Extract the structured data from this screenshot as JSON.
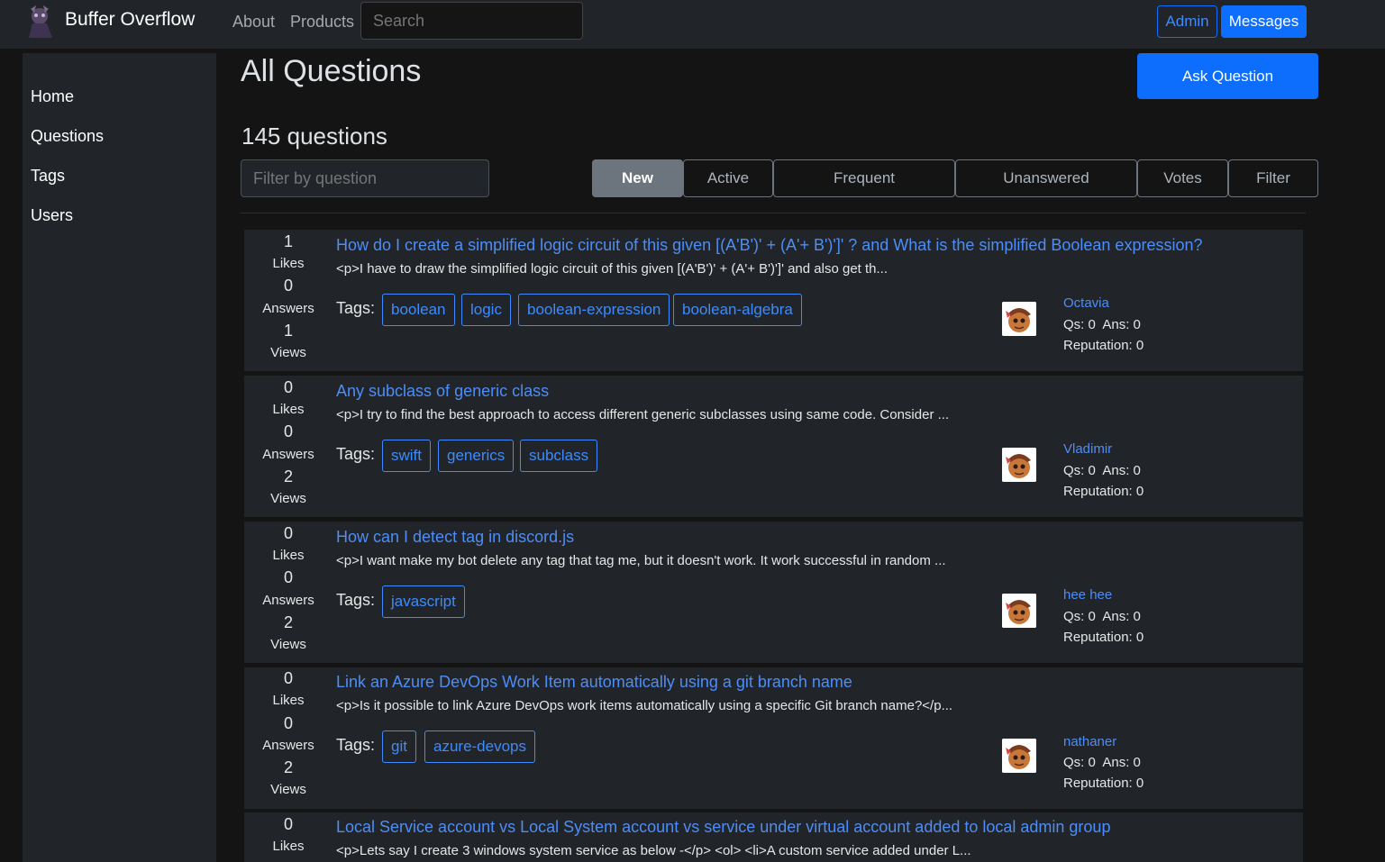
{
  "navbar": {
    "brand": "Buffer Overflow",
    "links": [
      "About",
      "Products"
    ],
    "search_placeholder": "Search",
    "admin_label": "Admin",
    "messages_label": "Messages"
  },
  "sidebar": {
    "items": [
      "Home",
      "Questions",
      "Tags",
      "Users"
    ]
  },
  "main": {
    "title": "All Questions",
    "ask_label": "Ask Question",
    "count": "145 questions",
    "filter_placeholder": "Filter by question",
    "tabs": [
      "New",
      "Active",
      "Frequent",
      "Unanswered",
      "Votes",
      "Filter"
    ],
    "active_tab": "New"
  },
  "labels": {
    "likes": "Likes",
    "answers": "Answers",
    "views": "Views",
    "tags": "Tags:"
  },
  "questions": [
    {
      "likes": "1",
      "answers": "0",
      "views": "1",
      "title": "How do I create a simplified logic circuit of this given [(A'B')' + (A'+ B')']' ? and What is the simplified Boolean expression?",
      "excerpt": "<p>I have to draw the simplified logic circuit of this given [(A'B')' + (A'+ B')']' and also get th...",
      "tags": [
        "boolean",
        "logic",
        "boolean-expression",
        "boolean-algebra"
      ],
      "author": "Octavia",
      "qs_ans": "Qs: 0  Ans: 0",
      "reputation": "Reputation: 0"
    },
    {
      "likes": "0",
      "answers": "0",
      "views": "2",
      "title": "Any subclass of generic class",
      "excerpt": "<p>I try to find the best approach to access different generic subclasses using same code. Consider ...",
      "tags": [
        "swift",
        "generics",
        "subclass"
      ],
      "author": "Vladimir",
      "qs_ans": "Qs: 0  Ans: 0",
      "reputation": "Reputation: 0"
    },
    {
      "likes": "0",
      "answers": "0",
      "views": "2",
      "title": "How can I detect tag in discord.js",
      "excerpt": "<p>I want make my bot delete any tag that tag me, but it doesn't work. It work successful in random ...",
      "tags": [
        "javascript"
      ],
      "author": "hee hee",
      "qs_ans": "Qs: 0  Ans: 0",
      "reputation": "Reputation: 0"
    },
    {
      "likes": "0",
      "answers": "0",
      "views": "2",
      "title": "Link an Azure DevOps Work Item automatically using a git branch name",
      "excerpt": "<p>Is it possible to link Azure DevOps work items automatically using a specific Git branch name?</p...",
      "tags": [
        "git",
        "azure-devops"
      ],
      "author": "nathaner",
      "qs_ans": "Qs: 0  Ans: 0",
      "reputation": "Reputation: 0"
    },
    {
      "likes": "0",
      "answers": "",
      "views": "",
      "title": "Local Service account vs Local System account vs service under virtual account added to local admin group",
      "excerpt": "<p>Lets say I create 3 windows system service as below -</p> <ol> <li>A custom service added under L...",
      "tags": [],
      "author": "",
      "qs_ans": "",
      "reputation": ""
    }
  ],
  "colors": {
    "accent": "#0d6efd",
    "link": "#4d8df6",
    "card": "#212529",
    "page": "#141414"
  }
}
